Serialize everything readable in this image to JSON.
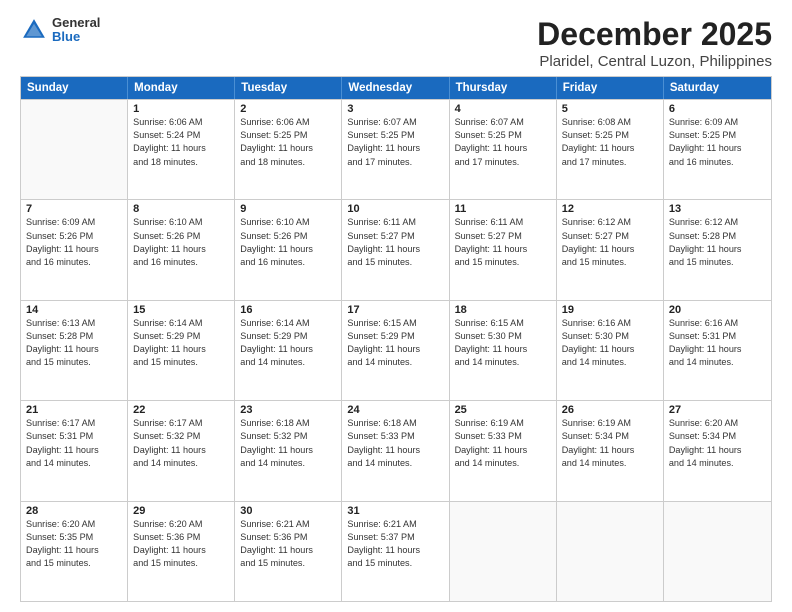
{
  "header": {
    "logo_general": "General",
    "logo_blue": "Blue",
    "month_year": "December 2025",
    "location": "Plaridel, Central Luzon, Philippines"
  },
  "weekdays": [
    "Sunday",
    "Monday",
    "Tuesday",
    "Wednesday",
    "Thursday",
    "Friday",
    "Saturday"
  ],
  "rows": [
    [
      {
        "day": "",
        "info": ""
      },
      {
        "day": "1",
        "info": "Sunrise: 6:06 AM\nSunset: 5:24 PM\nDaylight: 11 hours\nand 18 minutes."
      },
      {
        "day": "2",
        "info": "Sunrise: 6:06 AM\nSunset: 5:25 PM\nDaylight: 11 hours\nand 18 minutes."
      },
      {
        "day": "3",
        "info": "Sunrise: 6:07 AM\nSunset: 5:25 PM\nDaylight: 11 hours\nand 17 minutes."
      },
      {
        "day": "4",
        "info": "Sunrise: 6:07 AM\nSunset: 5:25 PM\nDaylight: 11 hours\nand 17 minutes."
      },
      {
        "day": "5",
        "info": "Sunrise: 6:08 AM\nSunset: 5:25 PM\nDaylight: 11 hours\nand 17 minutes."
      },
      {
        "day": "6",
        "info": "Sunrise: 6:09 AM\nSunset: 5:25 PM\nDaylight: 11 hours\nand 16 minutes."
      }
    ],
    [
      {
        "day": "7",
        "info": "Sunrise: 6:09 AM\nSunset: 5:26 PM\nDaylight: 11 hours\nand 16 minutes."
      },
      {
        "day": "8",
        "info": "Sunrise: 6:10 AM\nSunset: 5:26 PM\nDaylight: 11 hours\nand 16 minutes."
      },
      {
        "day": "9",
        "info": "Sunrise: 6:10 AM\nSunset: 5:26 PM\nDaylight: 11 hours\nand 16 minutes."
      },
      {
        "day": "10",
        "info": "Sunrise: 6:11 AM\nSunset: 5:27 PM\nDaylight: 11 hours\nand 15 minutes."
      },
      {
        "day": "11",
        "info": "Sunrise: 6:11 AM\nSunset: 5:27 PM\nDaylight: 11 hours\nand 15 minutes."
      },
      {
        "day": "12",
        "info": "Sunrise: 6:12 AM\nSunset: 5:27 PM\nDaylight: 11 hours\nand 15 minutes."
      },
      {
        "day": "13",
        "info": "Sunrise: 6:12 AM\nSunset: 5:28 PM\nDaylight: 11 hours\nand 15 minutes."
      }
    ],
    [
      {
        "day": "14",
        "info": "Sunrise: 6:13 AM\nSunset: 5:28 PM\nDaylight: 11 hours\nand 15 minutes."
      },
      {
        "day": "15",
        "info": "Sunrise: 6:14 AM\nSunset: 5:29 PM\nDaylight: 11 hours\nand 15 minutes."
      },
      {
        "day": "16",
        "info": "Sunrise: 6:14 AM\nSunset: 5:29 PM\nDaylight: 11 hours\nand 14 minutes."
      },
      {
        "day": "17",
        "info": "Sunrise: 6:15 AM\nSunset: 5:29 PM\nDaylight: 11 hours\nand 14 minutes."
      },
      {
        "day": "18",
        "info": "Sunrise: 6:15 AM\nSunset: 5:30 PM\nDaylight: 11 hours\nand 14 minutes."
      },
      {
        "day": "19",
        "info": "Sunrise: 6:16 AM\nSunset: 5:30 PM\nDaylight: 11 hours\nand 14 minutes."
      },
      {
        "day": "20",
        "info": "Sunrise: 6:16 AM\nSunset: 5:31 PM\nDaylight: 11 hours\nand 14 minutes."
      }
    ],
    [
      {
        "day": "21",
        "info": "Sunrise: 6:17 AM\nSunset: 5:31 PM\nDaylight: 11 hours\nand 14 minutes."
      },
      {
        "day": "22",
        "info": "Sunrise: 6:17 AM\nSunset: 5:32 PM\nDaylight: 11 hours\nand 14 minutes."
      },
      {
        "day": "23",
        "info": "Sunrise: 6:18 AM\nSunset: 5:32 PM\nDaylight: 11 hours\nand 14 minutes."
      },
      {
        "day": "24",
        "info": "Sunrise: 6:18 AM\nSunset: 5:33 PM\nDaylight: 11 hours\nand 14 minutes."
      },
      {
        "day": "25",
        "info": "Sunrise: 6:19 AM\nSunset: 5:33 PM\nDaylight: 11 hours\nand 14 minutes."
      },
      {
        "day": "26",
        "info": "Sunrise: 6:19 AM\nSunset: 5:34 PM\nDaylight: 11 hours\nand 14 minutes."
      },
      {
        "day": "27",
        "info": "Sunrise: 6:20 AM\nSunset: 5:34 PM\nDaylight: 11 hours\nand 14 minutes."
      }
    ],
    [
      {
        "day": "28",
        "info": "Sunrise: 6:20 AM\nSunset: 5:35 PM\nDaylight: 11 hours\nand 15 minutes."
      },
      {
        "day": "29",
        "info": "Sunrise: 6:20 AM\nSunset: 5:36 PM\nDaylight: 11 hours\nand 15 minutes."
      },
      {
        "day": "30",
        "info": "Sunrise: 6:21 AM\nSunset: 5:36 PM\nDaylight: 11 hours\nand 15 minutes."
      },
      {
        "day": "31",
        "info": "Sunrise: 6:21 AM\nSunset: 5:37 PM\nDaylight: 11 hours\nand 15 minutes."
      },
      {
        "day": "",
        "info": ""
      },
      {
        "day": "",
        "info": ""
      },
      {
        "day": "",
        "info": ""
      }
    ]
  ]
}
